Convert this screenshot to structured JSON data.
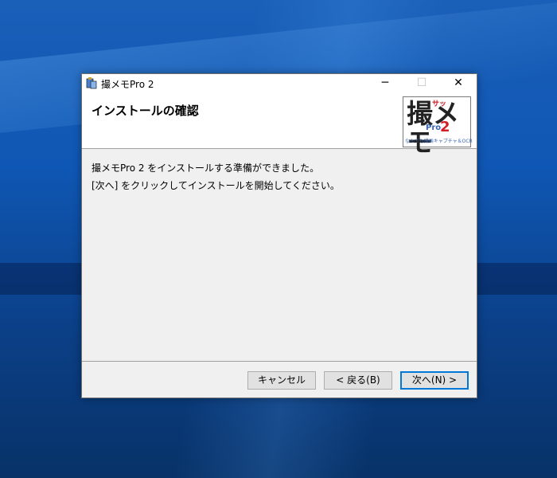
{
  "window": {
    "title": "撮メモPro 2"
  },
  "controls": {
    "minimize": "─",
    "maximize": "☐",
    "close": "✕"
  },
  "header": {
    "title": "インストールの確認",
    "logo": {
      "kanji": "撮メモ",
      "zatsu": "サッ",
      "pro": "Pro",
      "number": "2",
      "subtitle": "なんでも撮画キャプチャ＆OCR"
    }
  },
  "body": {
    "line1": "撮メモPro 2 をインストールする準備ができました。",
    "line2": "[次へ] をクリックしてインストールを開始してください。"
  },
  "buttons": {
    "cancel": "キャンセル",
    "back": "< 戻る(B)",
    "next": "次へ(N) >"
  }
}
